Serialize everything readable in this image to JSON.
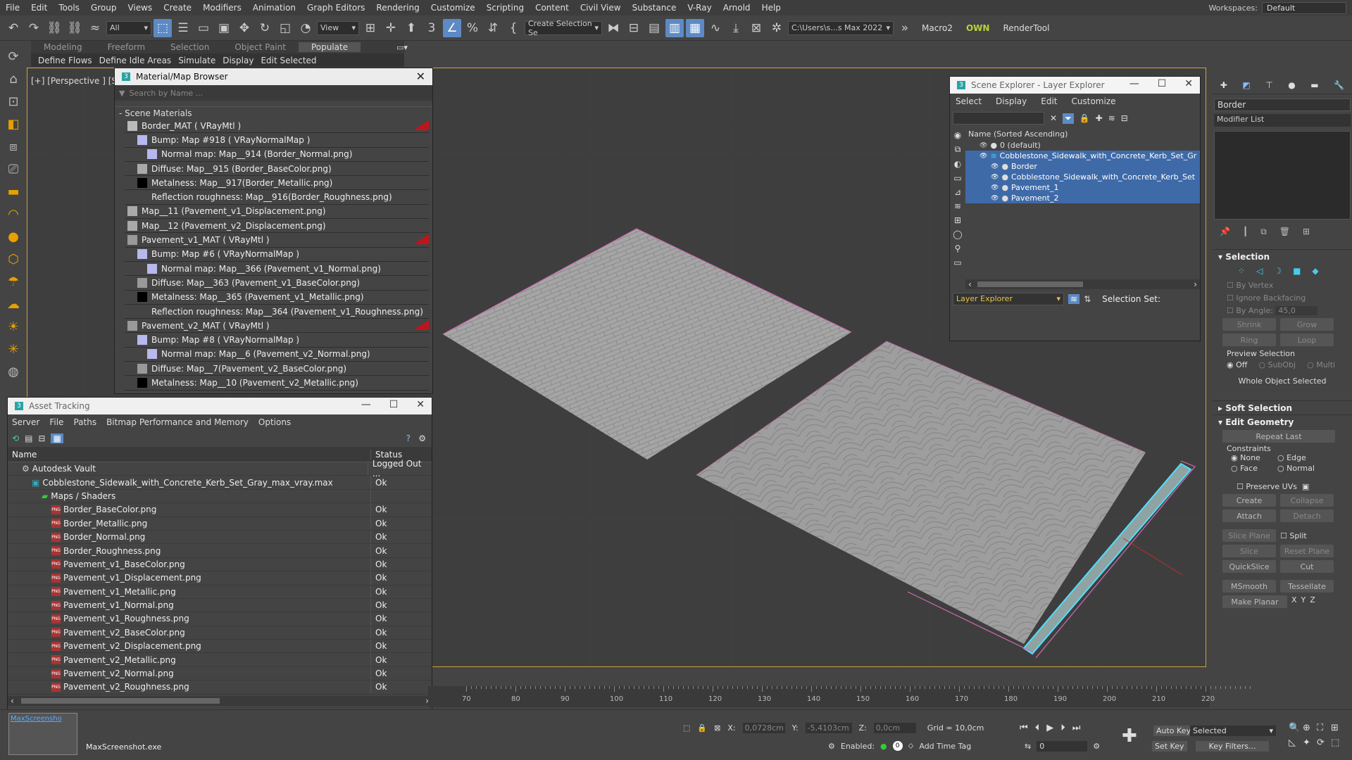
{
  "menu": [
    "File",
    "Edit",
    "Tools",
    "Group",
    "Views",
    "Create",
    "Modifiers",
    "Animation",
    "Graph Editors",
    "Rendering",
    "Customize",
    "Scripting",
    "Content",
    "Civil View",
    "Substance",
    "V-Ray",
    "Arnold",
    "Help"
  ],
  "workspaces_label": "Workspaces:",
  "workspaces_value": "Default",
  "toolbar": {
    "selection_filter": "All",
    "ref_coord": "View",
    "named_selection": "Create Selection Se",
    "path": "C:\\Users\\s...s Max 2022",
    "macro": "Macro2",
    "own": "OWN",
    "rendertool": "RenderTool",
    "snap_label": "3"
  },
  "ribbon_tabs": [
    "Modeling",
    "Freeform",
    "Selection",
    "Object Paint",
    "Populate"
  ],
  "ribbon_active": "Populate",
  "subribbon": [
    "Define Flows",
    "Define Idle Areas",
    "Simulate",
    "Display",
    "Edit Selected"
  ],
  "viewport_label": "[+] [Perspective ] [St",
  "material_browser": {
    "title": "Material/Map Browser",
    "search_placeholder": "Search by Name ...",
    "section": "- Scene Materials",
    "rows": [
      {
        "t": "Border_MAT  ( VRayMtl )",
        "lvl": 0,
        "sw": "#bbb",
        "red": true
      },
      {
        "t": "Bump: Map #918  ( VRayNormalMap )",
        "lvl": 1,
        "sw": "#b8b8ee"
      },
      {
        "t": "Normal map: Map__914 (Border_Normal.png)",
        "lvl": 2,
        "sw": "#b8b8ee"
      },
      {
        "t": "Diffuse: Map__915 (Border_BaseColor.png)",
        "lvl": 1,
        "sw": "#aaa"
      },
      {
        "t": "Metalness: Map__917(Border_Metallic.png)",
        "lvl": 1,
        "sw": "#000"
      },
      {
        "t": "Reflection roughness: Map__916(Border_Roughness.png)",
        "lvl": 1,
        "sw": "#444"
      },
      {
        "t": "Map__11 (Pavement_v1_Displacement.png)",
        "lvl": 0,
        "sw": "#aaa"
      },
      {
        "t": "Map__12 (Pavement_v2_Displacement.png)",
        "lvl": 0,
        "sw": "#aaa"
      },
      {
        "t": "Pavement_v1_MAT  ( VRayMtl )",
        "lvl": 0,
        "sw": "#999",
        "red": true
      },
      {
        "t": "Bump: Map #6  ( VRayNormalMap )",
        "lvl": 1,
        "sw": "#b8b8ee"
      },
      {
        "t": "Normal map: Map__366 (Pavement_v1_Normal.png)",
        "lvl": 2,
        "sw": "#b8b8ee"
      },
      {
        "t": "Diffuse: Map__363 (Pavement_v1_BaseColor.png)",
        "lvl": 1,
        "sw": "#999"
      },
      {
        "t": "Metalness: Map__365 (Pavement_v1_Metallic.png)",
        "lvl": 1,
        "sw": "#000"
      },
      {
        "t": "Reflection roughness: Map__364 (Pavement_v1_Roughness.png)",
        "lvl": 1,
        "sw": "#444"
      },
      {
        "t": "Pavement_v2_MAT  ( VRayMtl )",
        "lvl": 0,
        "sw": "#999",
        "red": true
      },
      {
        "t": "Bump: Map #8  ( VRayNormalMap )",
        "lvl": 1,
        "sw": "#b8b8ee"
      },
      {
        "t": "Normal map: Map__6 (Pavement_v2_Normal.png)",
        "lvl": 2,
        "sw": "#b8b8ee"
      },
      {
        "t": "Diffuse: Map__7(Pavement_v2_BaseColor.png)",
        "lvl": 1,
        "sw": "#999"
      },
      {
        "t": "Metalness: Map__10 (Pavement_v2_Metallic.png)",
        "lvl": 1,
        "sw": "#000"
      }
    ]
  },
  "asset_tracking": {
    "title": "Asset Tracking",
    "menu": [
      "Server",
      "File",
      "Paths",
      "Bitmap Performance and Memory",
      "Options"
    ],
    "col_name": "Name",
    "col_status": "Status",
    "rows": [
      {
        "n": "Autodesk Vault",
        "s": "Logged Out ...",
        "lvl": 0,
        "ic": "vault"
      },
      {
        "n": "Cobblestone_Sidewalk_with_Concrete_Kerb_Set_Gray_max_vray.max",
        "s": "Ok",
        "lvl": 1,
        "ic": "max"
      },
      {
        "n": "Maps / Shaders",
        "s": "",
        "lvl": 2,
        "ic": "folder"
      },
      {
        "n": "Border_BaseColor.png",
        "s": "Ok",
        "lvl": 3,
        "ic": "png"
      },
      {
        "n": "Border_Metallic.png",
        "s": "Ok",
        "lvl": 3,
        "ic": "png"
      },
      {
        "n": "Border_Normal.png",
        "s": "Ok",
        "lvl": 3,
        "ic": "png"
      },
      {
        "n": "Border_Roughness.png",
        "s": "Ok",
        "lvl": 3,
        "ic": "png"
      },
      {
        "n": "Pavement_v1_BaseColor.png",
        "s": "Ok",
        "lvl": 3,
        "ic": "png"
      },
      {
        "n": "Pavement_v1_Displacement.png",
        "s": "Ok",
        "lvl": 3,
        "ic": "png"
      },
      {
        "n": "Pavement_v1_Metallic.png",
        "s": "Ok",
        "lvl": 3,
        "ic": "png"
      },
      {
        "n": "Pavement_v1_Normal.png",
        "s": "Ok",
        "lvl": 3,
        "ic": "png"
      },
      {
        "n": "Pavement_v1_Roughness.png",
        "s": "Ok",
        "lvl": 3,
        "ic": "png"
      },
      {
        "n": "Pavement_v2_BaseColor.png",
        "s": "Ok",
        "lvl": 3,
        "ic": "png"
      },
      {
        "n": "Pavement_v2_Displacement.png",
        "s": "Ok",
        "lvl": 3,
        "ic": "png"
      },
      {
        "n": "Pavement_v2_Metallic.png",
        "s": "Ok",
        "lvl": 3,
        "ic": "png"
      },
      {
        "n": "Pavement_v2_Normal.png",
        "s": "Ok",
        "lvl": 3,
        "ic": "png"
      },
      {
        "n": "Pavement_v2_Roughness.png",
        "s": "Ok",
        "lvl": 3,
        "ic": "png"
      }
    ]
  },
  "scene_explorer": {
    "title": "Scene Explorer - Layer Explorer",
    "menu": [
      "Select",
      "Display",
      "Edit",
      "Customize"
    ],
    "header": "Name (Sorted Ascending)",
    "rows": [
      {
        "n": "0 (default)",
        "lvl": 0,
        "sel": false
      },
      {
        "n": "Cobblestone_Sidewalk_with_Concrete_Kerb_Set_Gr",
        "lvl": 0,
        "sel": true
      },
      {
        "n": "Border",
        "lvl": 1,
        "sel": true
      },
      {
        "n": "Cobblestone_Sidewalk_with_Concrete_Kerb_Set",
        "lvl": 1,
        "sel": true
      },
      {
        "n": "Pavement_1",
        "lvl": 1,
        "sel": true
      },
      {
        "n": "Pavement_2",
        "lvl": 1,
        "sel": true
      }
    ],
    "footer_mode": "Layer Explorer",
    "selection_set": "Selection Set:"
  },
  "command_panel": {
    "object_name": "Border",
    "modifier_list": "Modifier List",
    "selection": "Selection",
    "by_vertex": "By Vertex",
    "ignore_backfacing": "Ignore Backfacing",
    "by_angle": "By Angle:",
    "angle_val": "45,0",
    "shrink": "Shrink",
    "grow": "Grow",
    "ring": "Ring",
    "loop": "Loop",
    "preview_selection": "Preview Selection",
    "off": "Off",
    "subobj": "SubObj",
    "multi": "Multi",
    "whole_object": "Whole Object Selected",
    "soft_selection": "Soft Selection",
    "edit_geometry": "Edit Geometry",
    "repeat_last": "Repeat Last",
    "constraints": "Constraints",
    "none": "None",
    "edge": "Edge",
    "face": "Face",
    "normal": "Normal",
    "preserve_uvs": "Preserve UVs",
    "create": "Create",
    "collapse": "Collapse",
    "attach": "Attach",
    "detach": "Detach",
    "slice_plane": "Slice Plane",
    "split": "Split",
    "slice": "Slice",
    "reset_plane": "Reset Plane",
    "quickslice": "QuickSlice",
    "cut": "Cut",
    "msmooth": "MSmooth",
    "tessellate": "Tessellate",
    "make_planar": "Make Planar",
    "x": "X",
    "y": "Y",
    "z": "Z"
  },
  "timeline_ticks": [
    "70",
    "80",
    "90",
    "100",
    "110",
    "120",
    "130",
    "140",
    "150",
    "160",
    "170",
    "180",
    "190",
    "200",
    "210",
    "220"
  ],
  "status": {
    "x_label": "X:",
    "x_val": "0,0728cm",
    "y_label": "Y:",
    "y_val": "-5,4103cm",
    "z_label": "Z:",
    "z_val": "0,0cm",
    "grid": "Grid = 10,0cm",
    "enabled": "Enabled:",
    "add_time_tag": "Add Time Tag",
    "auto_key": "Auto Key",
    "selected": "Selected",
    "set_key": "Set Key",
    "key_filters": "Key Filters...",
    "frame": "0",
    "taskbar_app": "MaxScreenshot.exe",
    "taskbar_thumb": "MaxScreensho"
  }
}
